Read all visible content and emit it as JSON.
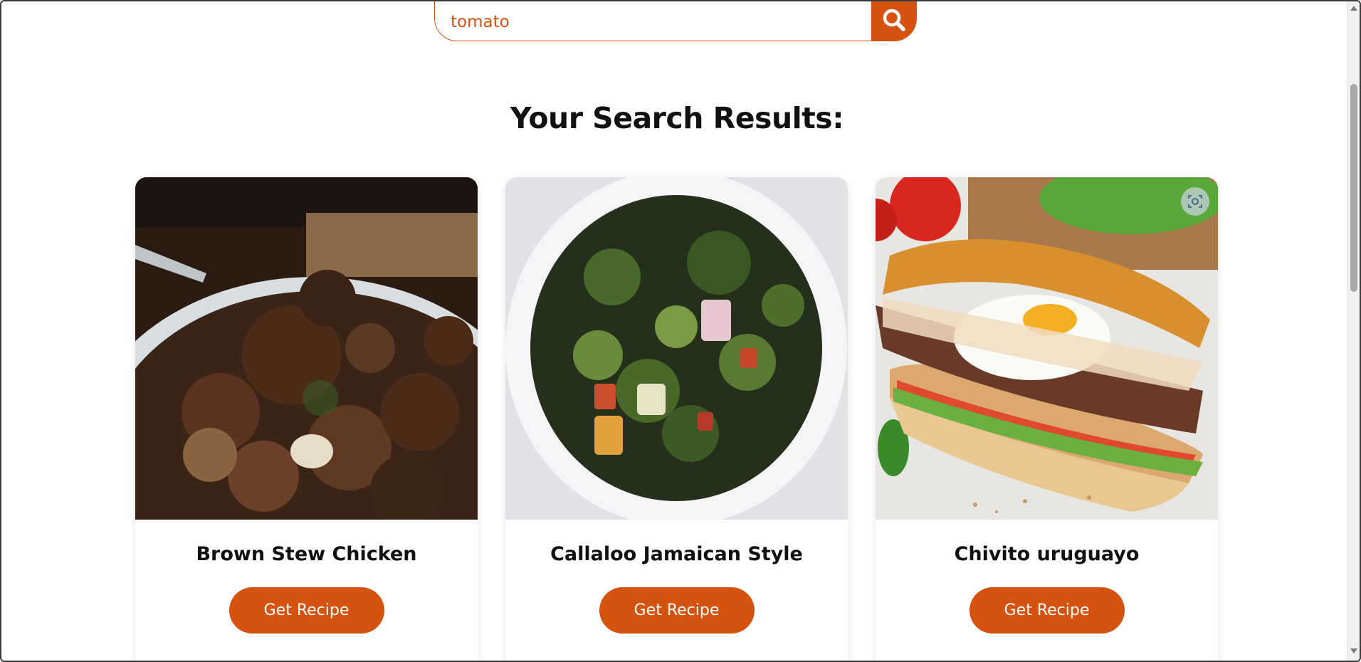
{
  "search": {
    "value": "tomato",
    "button_icon": "search-icon"
  },
  "results": {
    "title": "Your Search Results:",
    "cards": [
      {
        "title": "Brown Stew Chicken",
        "button_label": "Get Recipe"
      },
      {
        "title": "Callaloo Jamaican Style",
        "button_label": "Get Recipe"
      },
      {
        "title": "Chivito uruguayo",
        "button_label": "Get Recipe"
      }
    ]
  },
  "colors": {
    "accent": "#d5520f",
    "title": "#111111"
  },
  "icons": {
    "lens": "image-search-icon"
  }
}
